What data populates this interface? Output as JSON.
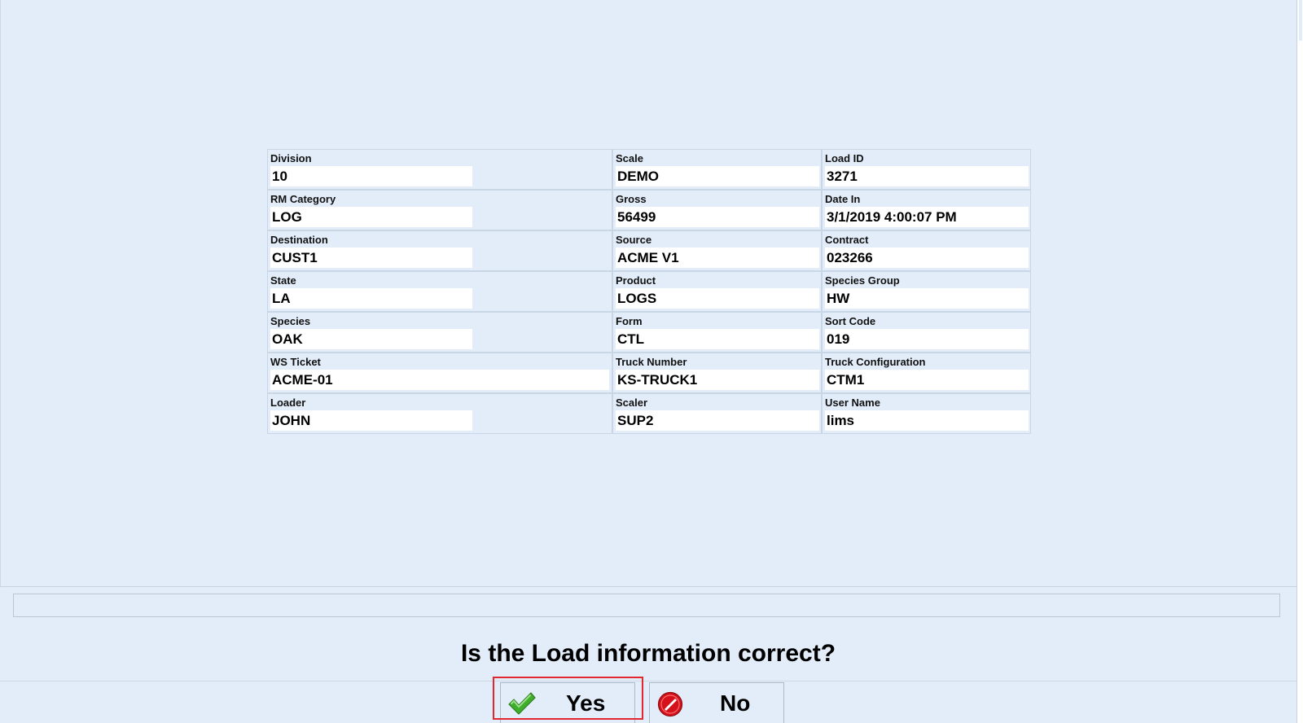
{
  "fields": [
    {
      "label": "Division",
      "value": "10"
    },
    {
      "label": "Scale",
      "value": "DEMO"
    },
    {
      "label": "Load ID",
      "value": "3271"
    },
    {
      "label": "RM Category",
      "value": "LOG"
    },
    {
      "label": "Gross",
      "value": "56499"
    },
    {
      "label": "Date In",
      "value": "3/1/2019 4:00:07 PM"
    },
    {
      "label": "Destination",
      "value": "CUST1"
    },
    {
      "label": "Source",
      "value": "ACME V1"
    },
    {
      "label": "Contract",
      "value": "023266"
    },
    {
      "label": "State",
      "value": "LA"
    },
    {
      "label": "Product",
      "value": "LOGS"
    },
    {
      "label": "Species Group",
      "value": "HW"
    },
    {
      "label": "Species",
      "value": "OAK"
    },
    {
      "label": "Form",
      "value": "CTL"
    },
    {
      "label": "Sort Code",
      "value": "019"
    },
    {
      "label": "WS Ticket",
      "value": "ACME-01"
    },
    {
      "label": "Truck Number",
      "value": "KS-TRUCK1"
    },
    {
      "label": "Truck Configuration",
      "value": "CTM1"
    },
    {
      "label": "Loader",
      "value": "JOHN"
    },
    {
      "label": "Scaler",
      "value": "SUP2"
    },
    {
      "label": "User Name",
      "value": "lims"
    }
  ],
  "message_bar": {
    "text": ""
  },
  "prompt": {
    "question": "Is the Load information correct?"
  },
  "buttons": {
    "yes_label": "Yes",
    "no_label": "No",
    "yes_icon": "checkmark-icon",
    "no_icon": "no-entry-icon"
  },
  "colors": {
    "background": "#e3edfa",
    "focus_ring": "#e0282e",
    "check_green": "#3fae2a",
    "no_red": "#d3121b"
  }
}
